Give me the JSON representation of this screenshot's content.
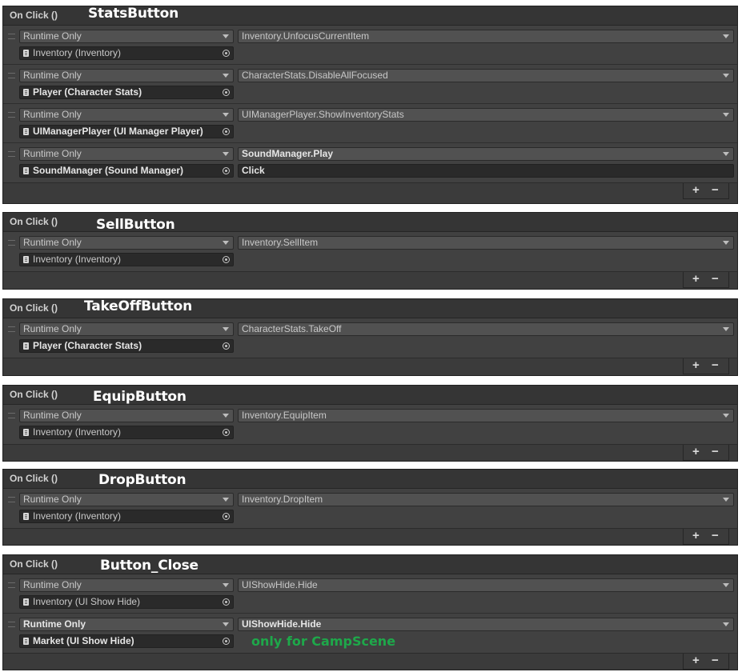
{
  "header_label": "On Click ()",
  "runtime_label": "Runtime Only",
  "add_symbol": "+",
  "remove_symbol": "−",
  "panels": [
    {
      "title": "StatsButton",
      "entries": [
        {
          "object": "Inventory (Inventory)",
          "function": "Inventory.UnfocusCurrentItem"
        },
        {
          "object": "Player (Character Stats)",
          "function": "CharacterStats.DisableAllFocused"
        },
        {
          "object": "UIManagerPlayer (UI Manager Player)",
          "function": "UIManagerPlayer.ShowInventoryStats"
        },
        {
          "object": "SoundManager (Sound Manager)",
          "function": "SoundManager.Play",
          "argument": "Click"
        }
      ]
    },
    {
      "title": "SellButton",
      "entries": [
        {
          "object": "Inventory (Inventory)",
          "function": "Inventory.SellItem"
        }
      ]
    },
    {
      "title": "TakeOffButton",
      "entries": [
        {
          "object": "Player (Character Stats)",
          "function": "CharacterStats.TakeOff"
        }
      ]
    },
    {
      "title": "EquipButton",
      "entries": [
        {
          "object": "Inventory (Inventory)",
          "function": "Inventory.EquipItem"
        }
      ]
    },
    {
      "title": "DropButton",
      "entries": [
        {
          "object": "Inventory (Inventory)",
          "function": "Inventory.DropItem"
        }
      ]
    },
    {
      "title": "Button_Close",
      "entries": [
        {
          "object": "Inventory (UI Show Hide)",
          "function": "UIShowHide.Hide"
        },
        {
          "object": "Market (UI Show Hide)",
          "function": "UIShowHide.Hide",
          "note": "only for CampScene"
        }
      ]
    }
  ]
}
